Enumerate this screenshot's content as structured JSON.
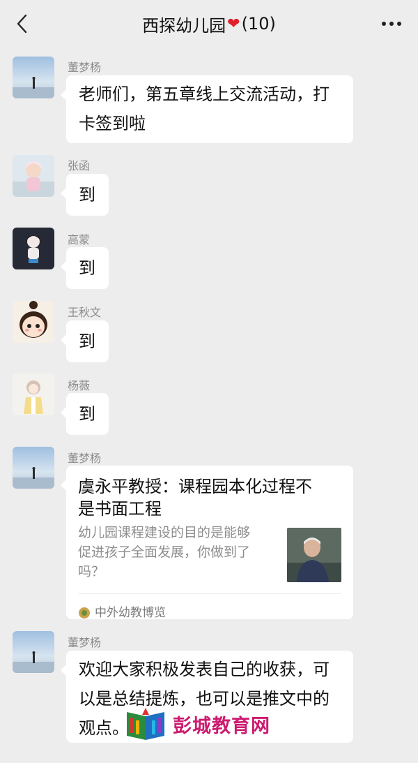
{
  "header": {
    "title": "西探幼儿园",
    "heart": "❤",
    "count": "(10)"
  },
  "messages": [
    {
      "sender": "董梦杨",
      "text_line1": "老师们，第五章线上交流活动，打",
      "text_line2": "卡签到啦"
    },
    {
      "sender": "张函",
      "text": "到"
    },
    {
      "sender": "高蒙",
      "text": "到"
    },
    {
      "sender": "王秋文",
      "text": "到"
    },
    {
      "sender": "杨薇",
      "text": "到"
    },
    {
      "sender": "董梦杨",
      "card": {
        "title_line1": "虞永平教授：课程园本化过程不",
        "title_line2": "是书面工程",
        "desc_line1": "幼儿园课程建设的目的是能够",
        "desc_line2": "促进孩子全面发展，你做到了",
        "desc_line3": "吗？",
        "source": "中外幼教博览"
      }
    },
    {
      "sender": "董梦杨",
      "text_line1": "欢迎大家积极发表自己的收获，可",
      "text_line2": "以是总结提炼，也可以是推文中的",
      "text_line3": "观点。"
    }
  ],
  "watermark": {
    "text": "彭城教育网"
  }
}
